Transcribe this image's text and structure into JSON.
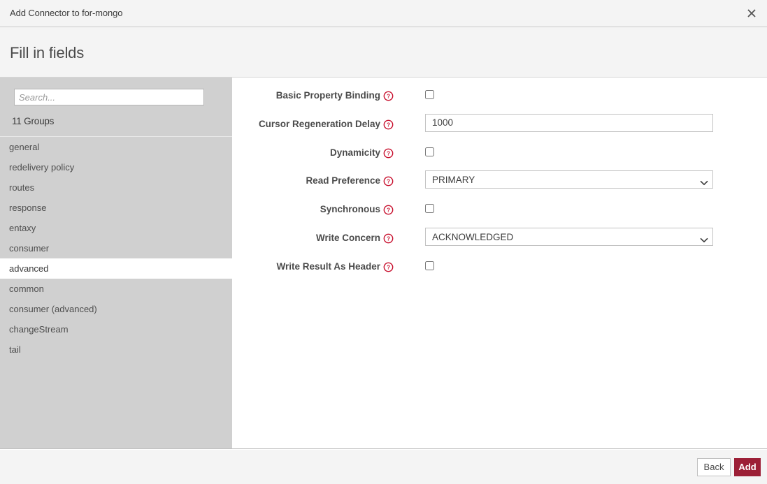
{
  "window": {
    "title": "Add Connector to for-mongo",
    "close_icon": "close-icon"
  },
  "header": {
    "title": "Fill in fields"
  },
  "sidebar": {
    "search_placeholder": "Search...",
    "search_value": "",
    "groups_count_label": "11 Groups",
    "selected_group": "advanced",
    "items": [
      {
        "label": "general"
      },
      {
        "label": "redelivery policy"
      },
      {
        "label": "routes"
      },
      {
        "label": "response"
      },
      {
        "label": "entaxy"
      },
      {
        "label": "consumer"
      },
      {
        "label": "advanced"
      },
      {
        "label": "common"
      },
      {
        "label": "consumer (advanced)"
      },
      {
        "label": "changeStream"
      },
      {
        "label": "tail"
      }
    ]
  },
  "form": {
    "help_icon": "help-circle-icon",
    "chevron_icon": "chevron-down-icon",
    "fields": [
      {
        "label": "Basic Property Binding",
        "type": "checkbox",
        "checked": false,
        "name": "basic-property-binding"
      },
      {
        "label": "Cursor Regeneration Delay",
        "type": "text",
        "value": "1000",
        "name": "cursor-regeneration-delay"
      },
      {
        "label": "Dynamicity",
        "type": "checkbox",
        "checked": false,
        "name": "dynamicity"
      },
      {
        "label": "Read Preference",
        "type": "select",
        "value": "PRIMARY",
        "options": [
          "PRIMARY"
        ],
        "name": "read-preference"
      },
      {
        "label": "Synchronous",
        "type": "checkbox",
        "checked": false,
        "name": "synchronous"
      },
      {
        "label": "Write Concern",
        "type": "select",
        "value": "ACKNOWLEDGED",
        "options": [
          "ACKNOWLEDGED"
        ],
        "name": "write-concern"
      },
      {
        "label": "Write Result As Header",
        "type": "checkbox",
        "checked": false,
        "name": "write-result-as-header"
      }
    ]
  },
  "footer": {
    "back_label": "Back",
    "add_label": "Add"
  },
  "colors": {
    "accent": "#9c1f36",
    "help_icon": "#c8102e",
    "sidebar_bg": "#d0d0d0",
    "header_bg": "#f4f4f4"
  }
}
